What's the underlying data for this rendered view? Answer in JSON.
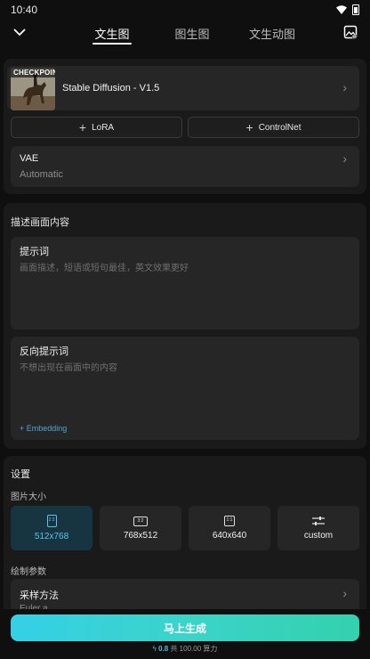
{
  "status_bar": {
    "time": "10:40"
  },
  "nav": {
    "tabs": [
      {
        "label": "文生图"
      },
      {
        "label": "图生图"
      },
      {
        "label": "文生动图"
      }
    ]
  },
  "checkpoint": {
    "tag": "CHECKPOINT",
    "model_name": "Stable Diffusion - V1.5"
  },
  "addons": {
    "lora_label": "LoRA",
    "controlnet_label": "ControlNet"
  },
  "vae": {
    "title": "VAE",
    "value": "Automatic"
  },
  "prompt_section": {
    "title": "描述画面内容",
    "prompt": {
      "title": "提示词",
      "placeholder": "画面描述，短语或短句最佳，英文效果更好"
    },
    "negative": {
      "title": "反向提示词",
      "placeholder": "不想出现在画面中的内容",
      "embedding_label": "Embedding"
    }
  },
  "settings": {
    "title": "设置",
    "size_label": "图片大小",
    "sizes": [
      {
        "ratio": "2:3",
        "label": "512x768",
        "selected": true
      },
      {
        "ratio": "3:2",
        "label": "768x512",
        "selected": false
      },
      {
        "ratio": "1:1",
        "label": "640x640",
        "selected": false
      },
      {
        "ratio": "",
        "label": "custom",
        "selected": false
      }
    ],
    "params_label": "绘制参数",
    "sampler": {
      "title": "采样方法",
      "value": "Euler a"
    }
  },
  "generate": {
    "button_label": "马上生成",
    "cost_amount": "0.8",
    "cost_total": "共 100.00 算力"
  },
  "colors": {
    "accent": "#4fb8dc",
    "selected_bg": "#173540",
    "button_gradient_start": "#35d0e6",
    "button_gradient_end": "#33d1ae"
  }
}
